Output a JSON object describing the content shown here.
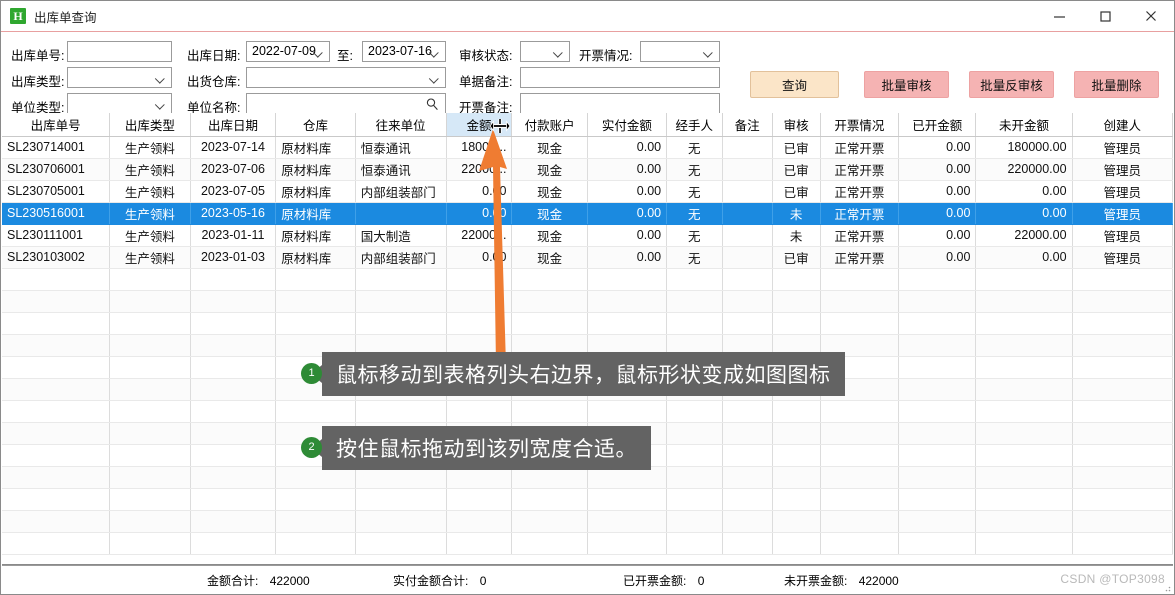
{
  "window": {
    "title": "出库单查询",
    "icon": "app-logo-icon",
    "minimize": "−",
    "maximize": "□",
    "close": "×"
  },
  "filters": {
    "rows": [
      {
        "label": "出库单号:",
        "value": "",
        "type": "text"
      },
      {
        "label": "出库日期:",
        "value": "2022-07-09",
        "type": "combo"
      },
      {
        "label": "至:",
        "value": "2023-07-16",
        "type": "combo"
      },
      {
        "label": "审核状态:",
        "value": "",
        "type": "combo"
      },
      {
        "label": "开票情况:",
        "value": "",
        "type": "combo"
      },
      {
        "label": "出库类型:",
        "value": "",
        "type": "combo"
      },
      {
        "label": "出货仓库:",
        "value": "",
        "type": "combo"
      },
      {
        "label": "单据备注:",
        "value": "",
        "type": "text"
      },
      {
        "label": "单位类型:",
        "value": "",
        "type": "combo"
      },
      {
        "label": "单位名称:",
        "value": "",
        "type": "search"
      },
      {
        "label": "开票备注:",
        "value": "",
        "type": "text"
      }
    ],
    "labels": {
      "order_no": "出库单号:",
      "out_date": "出库日期:",
      "to": "至:",
      "audit_status": "审核状态:",
      "invoice_status": "开票情况:",
      "out_type": "出库类型:",
      "warehouse": "出货仓库:",
      "doc_remark": "单据备注:",
      "unit_type": "单位类型:",
      "unit_name": "单位名称:",
      "invoice_remark": "开票备注:"
    },
    "values": {
      "order_no": "",
      "out_date": "2022-07-09",
      "to": "2023-07-16",
      "audit_status": "",
      "invoice_status": "",
      "out_type": "",
      "warehouse": "",
      "doc_remark": "",
      "unit_type": "",
      "unit_name": "",
      "invoice_remark": ""
    }
  },
  "buttons": {
    "query": "查询",
    "batch_audit": "批量审核",
    "batch_unaudit": "批量反审核",
    "batch_delete": "批量删除"
  },
  "grid": {
    "columns": [
      "出库单号",
      "出库类型",
      "出库日期",
      "仓库",
      "往来单位",
      "金额",
      "付款账户",
      "实付金额",
      "经手人",
      "备注",
      "审核",
      "开票情况",
      "已开金额",
      "未开金额",
      "创建人"
    ],
    "highlighted_column": "金额",
    "rows": [
      {
        "order_no": "SL230714001",
        "out_type": "生产领料",
        "out_date": "2023-07-14",
        "warehouse": "原材料库",
        "unit": "恒泰通讯",
        "amount": "18000...",
        "pay_account": "现金",
        "paid": "0.00",
        "handler": "无",
        "remark": "",
        "audit": "已审",
        "invoice": "正常开票",
        "invoiced": "0.00",
        "uninvoiced": "180000.00",
        "creator": "管理员",
        "selected": false
      },
      {
        "order_no": "SL230706001",
        "out_type": "生产领料",
        "out_date": "2023-07-06",
        "warehouse": "原材料库",
        "unit": "恒泰通讯",
        "amount": "22000...",
        "pay_account": "现金",
        "paid": "0.00",
        "handler": "无",
        "remark": "",
        "audit": "已审",
        "invoice": "正常开票",
        "invoiced": "0.00",
        "uninvoiced": "220000.00",
        "creator": "管理员",
        "selected": false
      },
      {
        "order_no": "SL230705001",
        "out_type": "生产领料",
        "out_date": "2023-07-05",
        "warehouse": "原材料库",
        "unit": "内部组装部门",
        "amount": "0.00",
        "pay_account": "现金",
        "paid": "0.00",
        "handler": "无",
        "remark": "",
        "audit": "已审",
        "invoice": "正常开票",
        "invoiced": "0.00",
        "uninvoiced": "0.00",
        "creator": "管理员",
        "selected": false
      },
      {
        "order_no": "SL230516001",
        "out_type": "生产领料",
        "out_date": "2023-05-16",
        "warehouse": "原材料库",
        "unit": "",
        "amount": "0.00",
        "pay_account": "现金",
        "paid": "0.00",
        "handler": "无",
        "remark": "",
        "audit": "未",
        "invoice": "正常开票",
        "invoiced": "0.00",
        "uninvoiced": "0.00",
        "creator": "管理员",
        "selected": true
      },
      {
        "order_no": "SL230111001",
        "out_type": "生产领料",
        "out_date": "2023-01-11",
        "warehouse": "原材料库",
        "unit": "国大制造",
        "amount": "22000...",
        "pay_account": "现金",
        "paid": "0.00",
        "handler": "无",
        "remark": "",
        "audit": "未",
        "invoice": "正常开票",
        "invoiced": "0.00",
        "uninvoiced": "22000.00",
        "creator": "管理员",
        "selected": false
      },
      {
        "order_no": "SL230103002",
        "out_type": "生产领料",
        "out_date": "2023-01-03",
        "warehouse": "原材料库",
        "unit": "内部组装部门",
        "amount": "0.00",
        "pay_account": "现金",
        "paid": "0.00",
        "handler": "无",
        "remark": "",
        "audit": "已审",
        "invoice": "正常开票",
        "invoiced": "0.00",
        "uninvoiced": "0.00",
        "creator": "管理员",
        "selected": false
      }
    ]
  },
  "annotations": {
    "steps": [
      {
        "number": "1",
        "text": "鼠标移动到表格列头右边界，鼠标形状变成如图图标"
      },
      {
        "number": "2",
        "text": "按住鼠标拖动到该列宽度合适。"
      }
    ],
    "arrow_color": "#ef7c32",
    "badge_color": "#2e8b36",
    "callout_color": "#636363",
    "cursor_icon": "column-resize-cursor-icon"
  },
  "statusbar": {
    "items": [
      {
        "label": "金额合计:",
        "value": "422000"
      },
      {
        "label": "实付金额合计:",
        "value": "0"
      },
      {
        "label": "已开票金额:",
        "value": "0"
      },
      {
        "label": "未开票金额:",
        "value": "422000"
      }
    ],
    "watermark": "CSDN @TOP3098"
  },
  "colors": {
    "accent_blue": "#1b8ae0",
    "header_highlight": "#d6e8f7",
    "query_button": "#fbe5c8",
    "danger_button": "#f5b3b3",
    "title_rule": "#e8a0a0"
  }
}
